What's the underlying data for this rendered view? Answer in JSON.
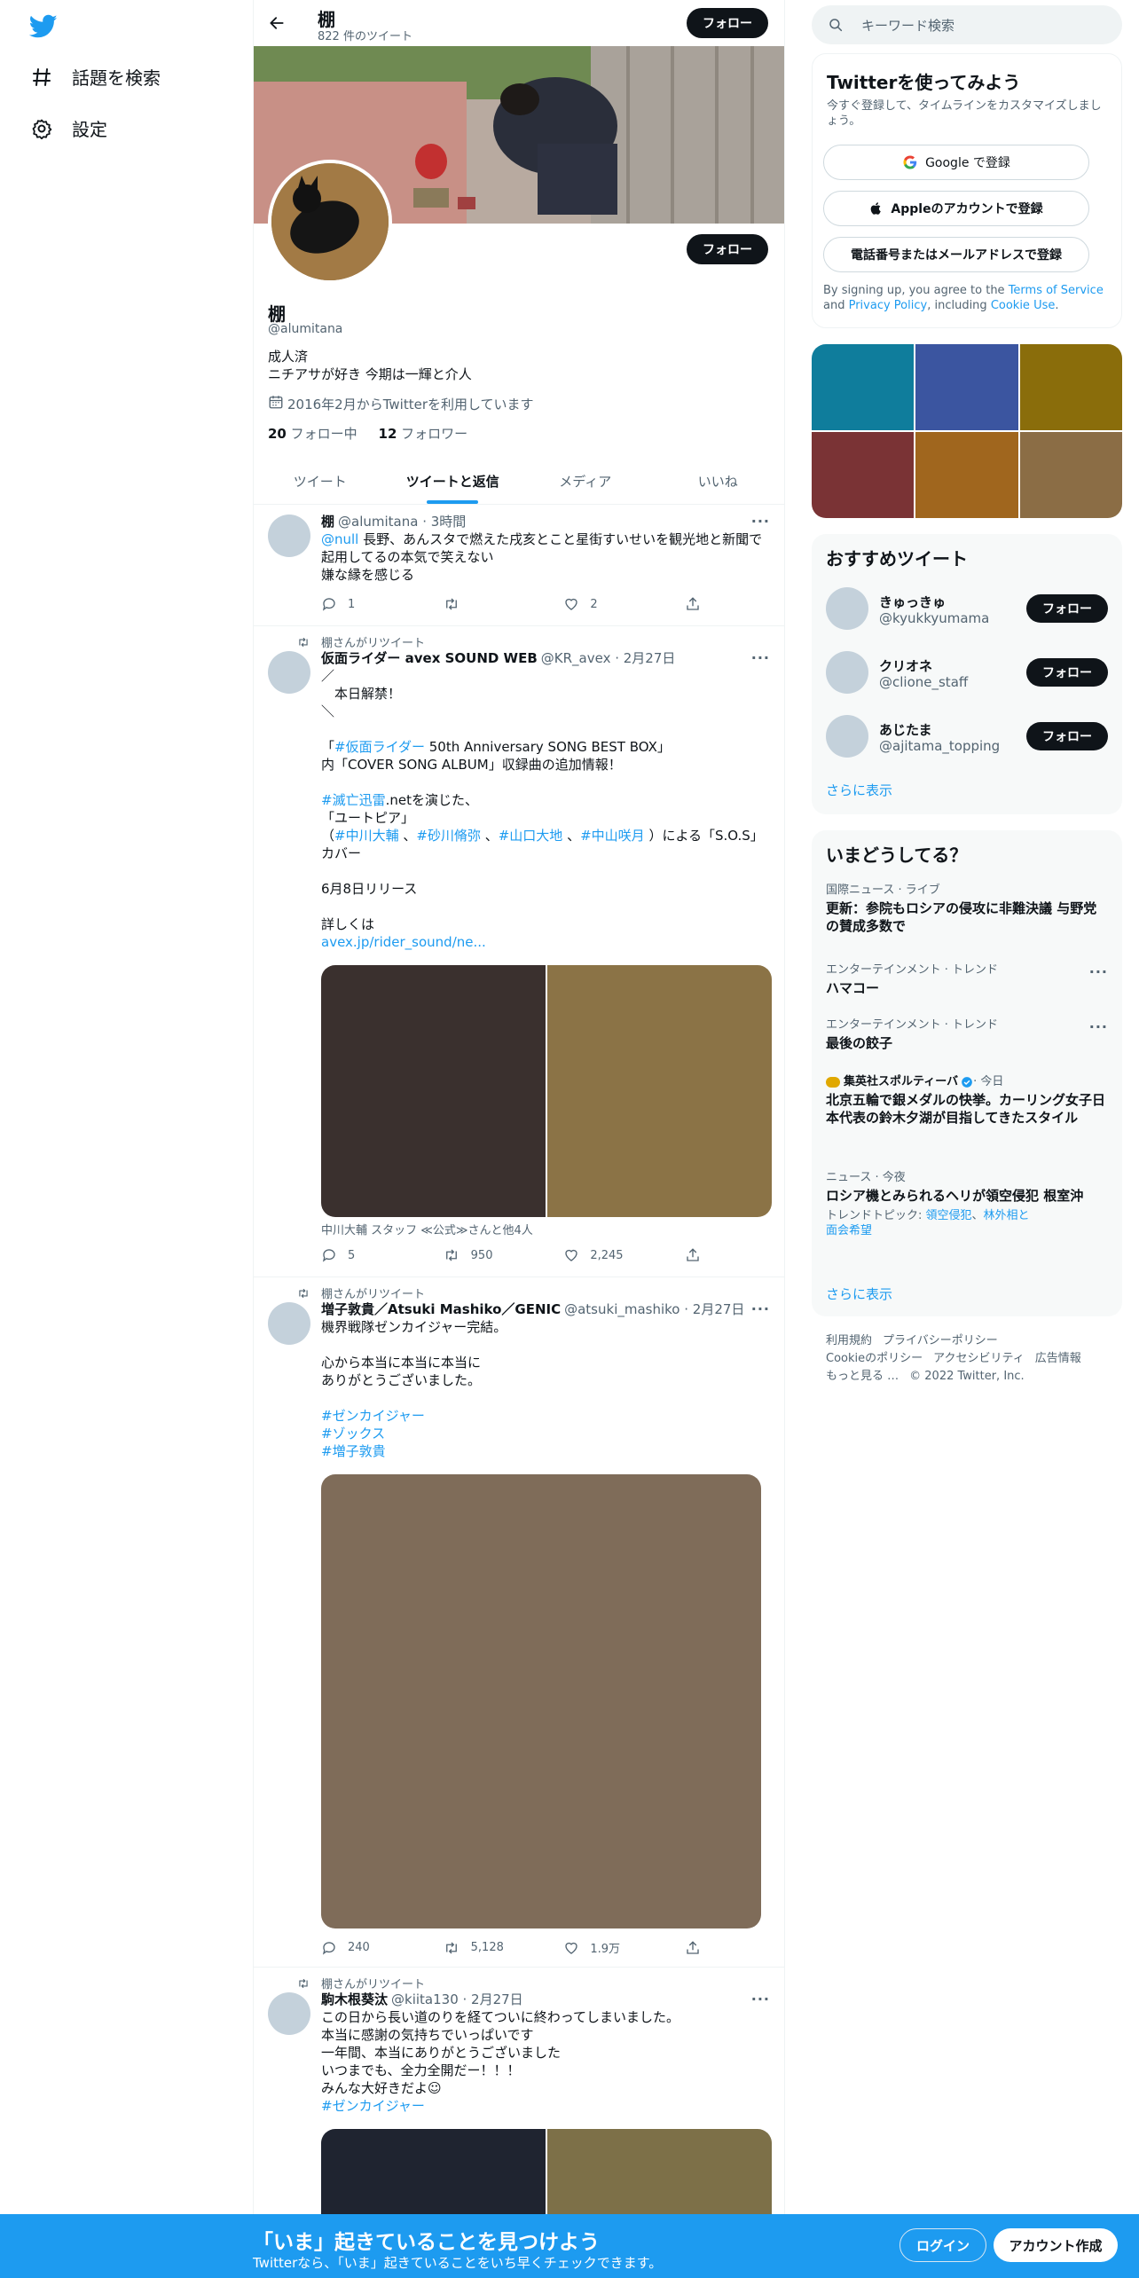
{
  "nav": {
    "explore_label": "話題を検索",
    "settings_label": "設定"
  },
  "profile": {
    "name": "棚",
    "tweet_count": "822 件のツイート",
    "follow_label": "フォロー",
    "handle": "@alumitana",
    "bio_line1": "成人済",
    "bio_line2": "ニチアサが好き 今期は一輝と介人",
    "joined": "2016年2月からTwitterを利用しています",
    "following_count": "20",
    "following_label": "フォロー中",
    "followers_count": "12",
    "followers_label": "フォロワー"
  },
  "tabs": [
    {
      "label": "ツイート"
    },
    {
      "label": "ツイートと返信"
    },
    {
      "label": "メディア"
    },
    {
      "label": "いいね"
    }
  ],
  "tweets": [
    {
      "name": "棚",
      "meta": "@alumitana · 3時間",
      "mention": "@null",
      "text": " 長野、あんスタで燃えた戌亥とこと星街すいせいを観光地と新聞で起用してるの本気で笑えない\n嫌な縁を感じる",
      "replies": "1",
      "retweets": "",
      "likes": "2"
    },
    {
      "retweet_by": "棚さんがリツイート",
      "name": "仮面ライダー avex SOUND WEB",
      "meta": "@KR_avex · 2月27日",
      "text_a": "／\n　本日解禁！\n＼\n\n「",
      "tag_a": "#仮面ライダー",
      "text_b": " 50th Anniversary SONG BEST BOX」\n内「COVER SONG ALBUM」収録曲の追加情報！\n\n",
      "tag_b": "#滅亡迅雷",
      "text_c": ".netを演じた、\n「ユートピア」\n（",
      "tag_c": "#中川大輔",
      "sep1": " 、",
      "tag_d": "#砂川脩弥",
      "sep2": " 、",
      "tag_e": "#山口大地",
      "sep3": " 、",
      "tag_f": "#中山咲月",
      "text_d": " ）による「S.O.S」カバー\n\n6月8日リリース\n\n詳しくは\n",
      "link": "avex.jp/rider_sound/ne...",
      "media_tags": "中川大輔 スタッフ ≪公式≫さんと他4人",
      "replies": "5",
      "retweets": "950",
      "likes": "2,245"
    },
    {
      "retweet_by": "棚さんがリツイート",
      "name": "増子敦貴／Atsuki Mashiko／GENIC",
      "meta": "@atsuki_mashiko · 2月27日",
      "text": "機界戦隊ゼンカイジャー完結。\n\n心から本当に本当に本当に\nありがとうございました。\n\n",
      "tag1": "#ゼンカイジャー",
      "tag2": "#ゾックス",
      "tag3": "#増子敦貴",
      "replies": "240",
      "retweets": "5,128",
      "likes": "1.9万"
    },
    {
      "retweet_by": "棚さんがリツイート",
      "name": "駒木根葵汰",
      "meta": "@kiita130 · 2月27日",
      "text": "この日から長い道のりを経てついに終わってしまいました。\n本当に感謝の気持ちでいっぱいです\n一年間、本当にありがとうございました\nいつまでも、全力全開だー！！！\nみんな大好きだよ☺︎\n",
      "tag": "#ゼンカイジャー"
    }
  ],
  "search": {
    "placeholder": "キーワード検索"
  },
  "signup": {
    "title": "Twitterを使ってみよう",
    "subtitle": "今すぐ登録して、タイムラインをカスタマイズしましょう。",
    "google": "Google で登録",
    "apple": "Appleのアカウントで登録",
    "phone": "電話番号またはメールアドレスで登録",
    "legal_a": "By signing up, you agree to the ",
    "legal_terms": "Terms of Service",
    "legal_b": " and ",
    "legal_privacy": "Privacy Policy",
    "legal_c": ", including ",
    "legal_cookie": "Cookie Use",
    "legal_d": "."
  },
  "recs": {
    "title": "おすすめツイート",
    "items": [
      {
        "name": "きゅっきゅ",
        "handle": "@kyukkyumama"
      },
      {
        "name": "クリオネ",
        "handle": "@clione_staff"
      },
      {
        "name": "あじたま",
        "handle": "@ajitama_topping"
      }
    ],
    "follow_label": "フォロー",
    "more": "さらに表示"
  },
  "trends": {
    "title": "いまどうしてる？",
    "items": [
      {
        "cat": "国際ニュース · ライブ",
        "title": "更新：参院もロシアの侵攻に非難決議 与野党の賛成多数で"
      },
      {
        "cat": "エンターテインメント · トレンド",
        "title": "ハマコー"
      },
      {
        "cat": "エンターテインメント · トレンド",
        "title": "最後の餃子"
      },
      {
        "cat_source": "集英社スポルティーバ",
        "cat_time": " · 今日",
        "title": "北京五輪で銀メダルの快挙。カーリング女子日本代表の鈴木夕湖が目指してきたスタイル"
      },
      {
        "cat": "ニュース · 今夜",
        "title": "ロシア機とみられるヘリが領空侵犯 根室沖",
        "topics_label": "トレンドトピック: ",
        "topic1": "領空侵犯",
        "topic_sep": "、",
        "topic2": "林外相と",
        "topic3": "面会希望"
      }
    ],
    "more": "さらに表示"
  },
  "footer": {
    "terms": "利用規約",
    "privacy": "プライバシーポリシー",
    "cookie": "Cookieのポリシー",
    "access": "アクセシビリティ",
    "ads": "広告情報",
    "more": "もっと見る …",
    "copy": "© 2022 Twitter, Inc."
  },
  "bottombar": {
    "title": "「いま」起きていることを見つけよう",
    "subtitle": "Twitterなら、「いま」起きていることをいち早くチェックできます。",
    "login": "ログイン",
    "signup": "アカウント作成"
  },
  "colors": {
    "accent": "#1d9bf0",
    "text": "#0f1419",
    "muted": "#536471"
  }
}
